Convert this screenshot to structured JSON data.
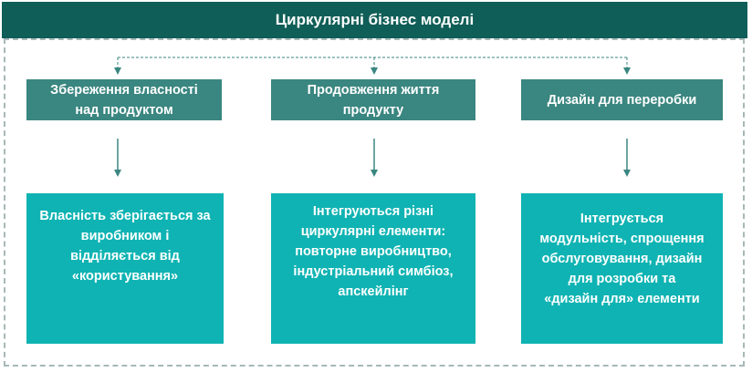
{
  "title": "Циркулярні бізнес моделі",
  "columns": [
    {
      "heading_lines": [
        "Збереження власності",
        "над продуктом"
      ],
      "body_lines": [
        "Власність зберігається за",
        "виробником і",
        "відділяється від",
        "«користування»"
      ]
    },
    {
      "heading_lines": [
        "Продовження життя",
        "продукту"
      ],
      "body_lines": [
        "Інтегруються різні",
        "циркулярні елементи:",
        "повторне виробництво,",
        "індустріальний симбіоз,",
        "апскейлінг"
      ]
    },
    {
      "heading_lines": [
        "Дизайн для переробки"
      ],
      "body_lines": [
        "Інтегрується",
        "модульність, спрощення",
        "обслуговування, дизайн",
        "для розробки та",
        "«дизайн для» елементи"
      ]
    }
  ],
  "colors": {
    "title_bg": "#0f5e57",
    "heading_bg": "#3a8680",
    "body_bg": "#10b3b3",
    "connector": "#3a8680",
    "frame": "#a7b8b8"
  }
}
